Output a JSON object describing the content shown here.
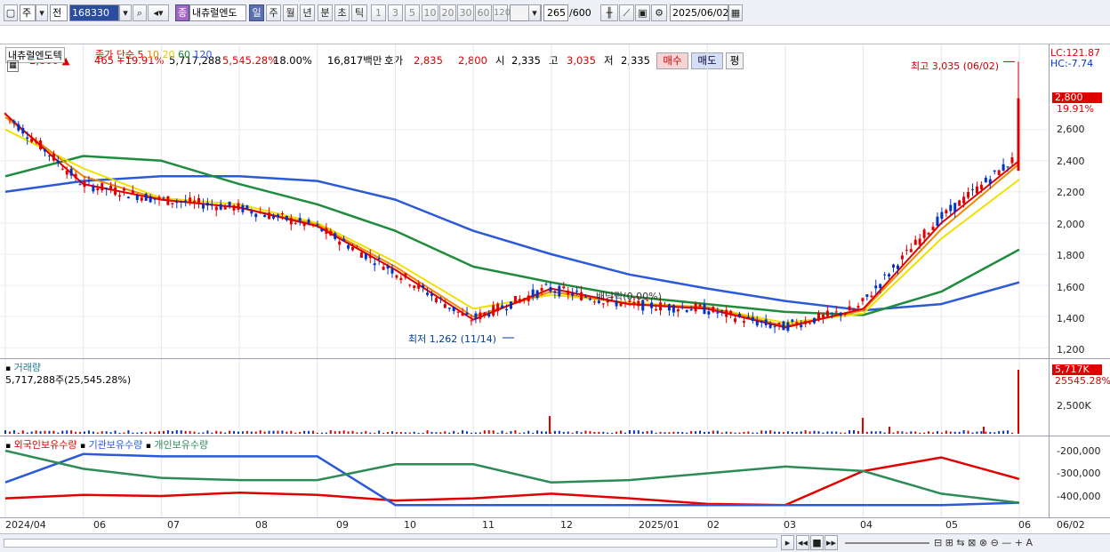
{
  "toolbar": {
    "market": "주",
    "market2": "전",
    "code": "168330",
    "stock_badge": "종",
    "stock_name": "내츄럴엔도",
    "periods": [
      "일",
      "주",
      "월",
      "년",
      "분",
      "초",
      "틱"
    ],
    "intervals": [
      "1",
      "3",
      "5",
      "10",
      "20",
      "30",
      "60",
      "120"
    ],
    "count": "265",
    "count_total": "/600",
    "date": "2025/06/02"
  },
  "quote": {
    "price": "2,800",
    "change": "465",
    "change_pct": "+19.91%",
    "volume": "5,717,288",
    "volume_ratio": "5,545.28%",
    "turnover": "18.00%",
    "amount": "16,817백만",
    "hoga_label": "호가",
    "hoga_sell": "2,835",
    "hoga_buy": "2,800",
    "open_label": "시",
    "open": "2,335",
    "high_label": "고",
    "high": "3,035",
    "low_label": "저",
    "low": "2,335",
    "buy_btn": "매수",
    "sell_btn": "매도",
    "eval_btn": "평"
  },
  "price_panel": {
    "name_label": "내츄럴엔도텍",
    "ma_label": "종가 단순",
    "ma_periods": [
      "5",
      "10",
      "20",
      "60",
      "120"
    ],
    "lc": "LC:121.87",
    "hc": "HC:-7.74",
    "high_note": "최고 3,035 (06/02)",
    "low_note": "최저 1,262 (11/14)",
    "div_note": "배당락(0.00%)",
    "current_flag": "2,800",
    "current_pct": "19.91%",
    "y_ticks": [
      "2,600",
      "2,400",
      "2,200",
      "2,000",
      "1,800",
      "1,600",
      "1,400",
      "1,200"
    ]
  },
  "volume_panel": {
    "title": "거래량",
    "value": "5,717,288주(25,545.28%)",
    "flag": "5,717K",
    "pct": "25545.28%",
    "tick": "2,500K"
  },
  "holding_panel": {
    "series": [
      "외국인보유수량",
      "기관보유수량",
      "개인보유수량"
    ],
    "y_ticks": [
      "-200,000",
      "-300,000",
      "-400,000"
    ]
  },
  "x_ticks": [
    "2024/04",
    "06",
    "07",
    "08",
    "09",
    "10",
    "11",
    "12",
    "2025/01",
    "02",
    "03",
    "04",
    "05",
    "06"
  ],
  "x_right": "06/02",
  "colors": {
    "up": "#e00000",
    "down": "#0032c8",
    "ma5": "#e00000",
    "ma10": "#f08a00",
    "ma20": "#f0e000",
    "ma60": "#1e8c3c",
    "ma120": "#2a5ad8",
    "foreign": "#e00000",
    "inst": "#2a5ad8",
    "indiv": "#2e8b57"
  },
  "chart_data": {
    "type": "line",
    "x": [
      "2024/04",
      "06",
      "07",
      "08",
      "09",
      "10",
      "11",
      "12",
      "2025/01",
      "02",
      "03",
      "04",
      "05",
      "06"
    ],
    "series": [
      {
        "name": "5",
        "values": [
          2700,
          2250,
          2150,
          2100,
          1980,
          1700,
          1380,
          1580,
          1480,
          1450,
          1330,
          1450,
          2000,
          2400
        ]
      },
      {
        "name": "10",
        "values": [
          2680,
          2300,
          2150,
          2100,
          1990,
          1720,
          1400,
          1560,
          1480,
          1460,
          1340,
          1440,
          1960,
          2380
        ]
      },
      {
        "name": "20",
        "values": [
          2600,
          2350,
          2160,
          2120,
          2000,
          1750,
          1450,
          1540,
          1490,
          1460,
          1360,
          1420,
          1900,
          2280
        ]
      },
      {
        "name": "60",
        "values": [
          2300,
          2430,
          2400,
          2250,
          2120,
          1950,
          1720,
          1620,
          1530,
          1480,
          1430,
          1410,
          1560,
          1830
        ]
      },
      {
        "name": "120",
        "values": [
          2200,
          2270,
          2300,
          2300,
          2270,
          2150,
          1950,
          1800,
          1670,
          1580,
          1500,
          1440,
          1480,
          1620
        ]
      }
    ],
    "ylim": [
      1150,
      3100
    ],
    "annotations": [
      "최고 3,035 (06/02)",
      "최저 1,262 (11/14)",
      "배당락(0.00%)"
    ]
  }
}
